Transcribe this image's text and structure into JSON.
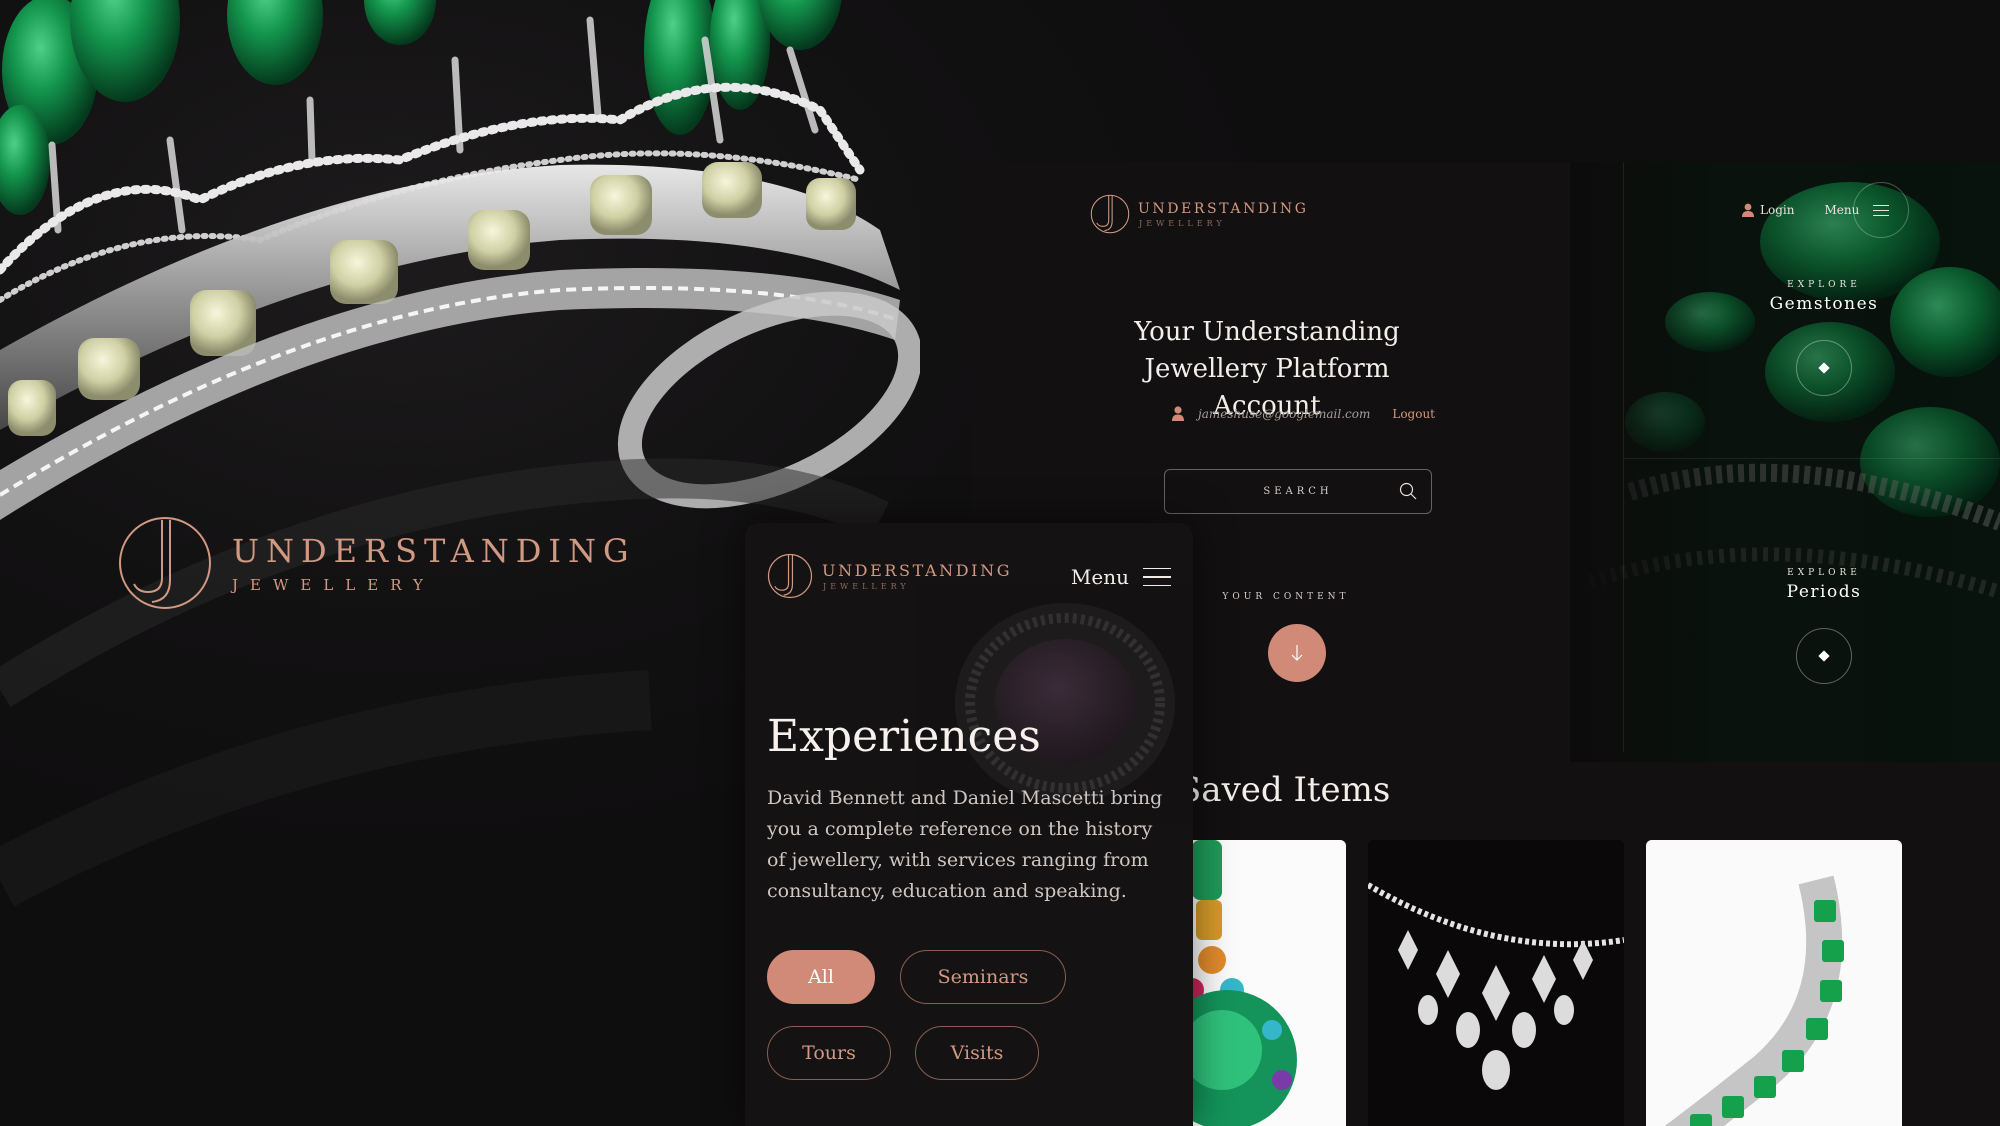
{
  "brand": {
    "name": "UNDERSTANDING",
    "sub": "JEWELLERY",
    "accent": "#d29982"
  },
  "desktop": {
    "nav": {
      "login": "Login",
      "menu": "Menu"
    },
    "title_line1": "Your Understanding",
    "title_line2": "Jewellery Platform Account",
    "email": "jameshuse@googlemail.com",
    "logout": "Logout",
    "search_placeholder": "SEARCH",
    "your_content": "YOUR CONTENT",
    "explore": [
      {
        "kicker": "EXPLORE",
        "label": "Gemstones"
      },
      {
        "kicker": "EXPLORE",
        "label": "Periods"
      }
    ],
    "saved_title": "Saved Items"
  },
  "mobile": {
    "menu": "Menu",
    "title": "Experiences",
    "description": "David Bennett and Daniel Mascetti bring you a complete reference on the history of jewellery, with services ranging from consultancy, education and speaking.",
    "filters": [
      {
        "label": "All",
        "active": true
      },
      {
        "label": "Seminars",
        "active": false
      },
      {
        "label": "Tours",
        "active": false
      },
      {
        "label": "Visits",
        "active": false
      }
    ]
  },
  "icons": [
    "logo-monogram-icon",
    "user-icon",
    "hamburger-icon",
    "search-icon",
    "arrow-down-icon",
    "diamond-icon"
  ]
}
